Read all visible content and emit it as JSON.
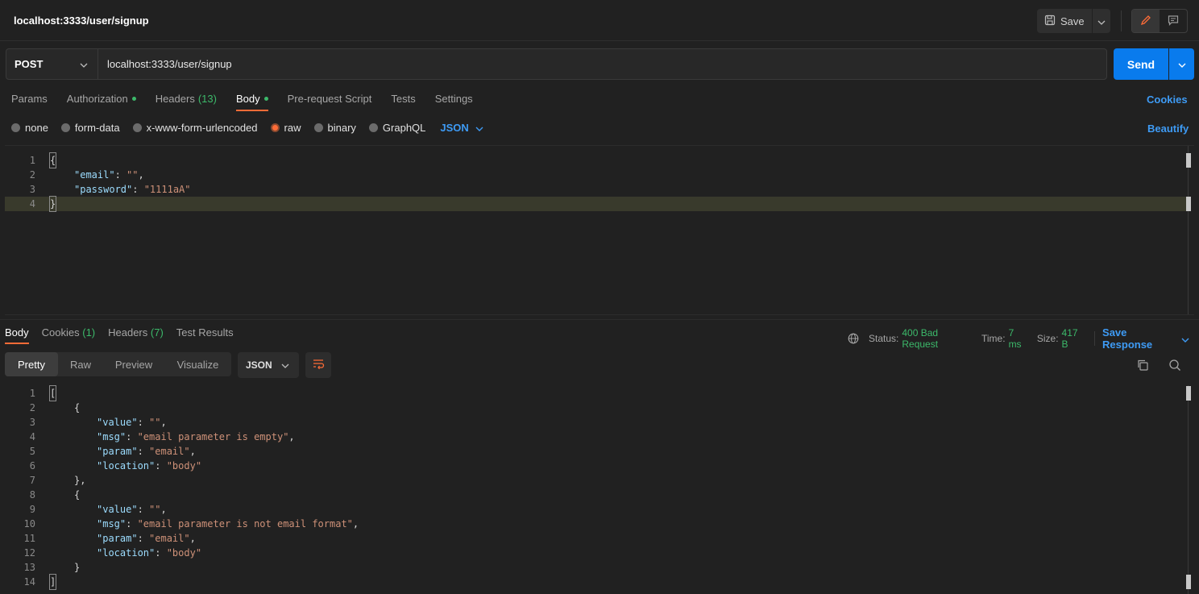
{
  "header": {
    "title": "localhost:3333/user/signup",
    "save_label": "Save"
  },
  "request": {
    "method": "POST",
    "url": "localhost:3333/user/signup",
    "send_label": "Send",
    "tabs": [
      {
        "label": "Params",
        "count": "",
        "dot": false
      },
      {
        "label": "Authorization",
        "count": "",
        "dot": true
      },
      {
        "label": "Headers",
        "count": "(13)",
        "dot": false
      },
      {
        "label": "Body",
        "count": "",
        "dot": true
      },
      {
        "label": "Pre-request Script",
        "count": "",
        "dot": false
      },
      {
        "label": "Tests",
        "count": "",
        "dot": false
      },
      {
        "label": "Settings",
        "count": "",
        "dot": false
      }
    ],
    "cookies_label": "Cookies",
    "body_types": [
      "none",
      "form-data",
      "x-www-form-urlencoded",
      "raw",
      "binary",
      "GraphQL"
    ],
    "selected_body_type": "raw",
    "body_format": "JSON",
    "beautify_label": "Beautify",
    "body_lines": [
      {
        "n": "1",
        "text": "{"
      },
      {
        "n": "2",
        "text": "\"email\": \"\","
      },
      {
        "n": "3",
        "text": "\"password\": \"1111aA\""
      },
      {
        "n": "4",
        "text": "}"
      }
    ]
  },
  "response": {
    "tabs": [
      {
        "label": "Body",
        "count": ""
      },
      {
        "label": "Cookies",
        "count": "(1)"
      },
      {
        "label": "Headers",
        "count": "(7)"
      },
      {
        "label": "Test Results",
        "count": ""
      }
    ],
    "status_label": "Status:",
    "status_value": "400 Bad Request",
    "time_label": "Time:",
    "time_value": "7 ms",
    "size_label": "Size:",
    "size_value": "417 B",
    "save_response_label": "Save Response",
    "formats": [
      "Pretty",
      "Raw",
      "Preview",
      "Visualize"
    ],
    "selected_format": "Pretty",
    "language": "JSON",
    "lines": [
      {
        "n": "1",
        "text": "["
      },
      {
        "n": "2",
        "text": "{"
      },
      {
        "n": "3",
        "text": "\"value\": \"\","
      },
      {
        "n": "4",
        "text": "\"msg\": \"email parameter is empty\","
      },
      {
        "n": "5",
        "text": "\"param\": \"email\","
      },
      {
        "n": "6",
        "text": "\"location\": \"body\""
      },
      {
        "n": "7",
        "text": "},"
      },
      {
        "n": "8",
        "text": "{"
      },
      {
        "n": "9",
        "text": "\"value\": \"\","
      },
      {
        "n": "10",
        "text": "\"msg\": \"email parameter is not email format\","
      },
      {
        "n": "11",
        "text": "\"param\": \"email\","
      },
      {
        "n": "12",
        "text": "\"location\": \"body\""
      },
      {
        "n": "13",
        "text": "}"
      },
      {
        "n": "14",
        "text": "]"
      }
    ]
  },
  "colors": {
    "accent_orange": "#ff6c37",
    "send_blue": "#097bed",
    "link_blue": "#3e9bf5",
    "status_green": "#3cb96a"
  }
}
